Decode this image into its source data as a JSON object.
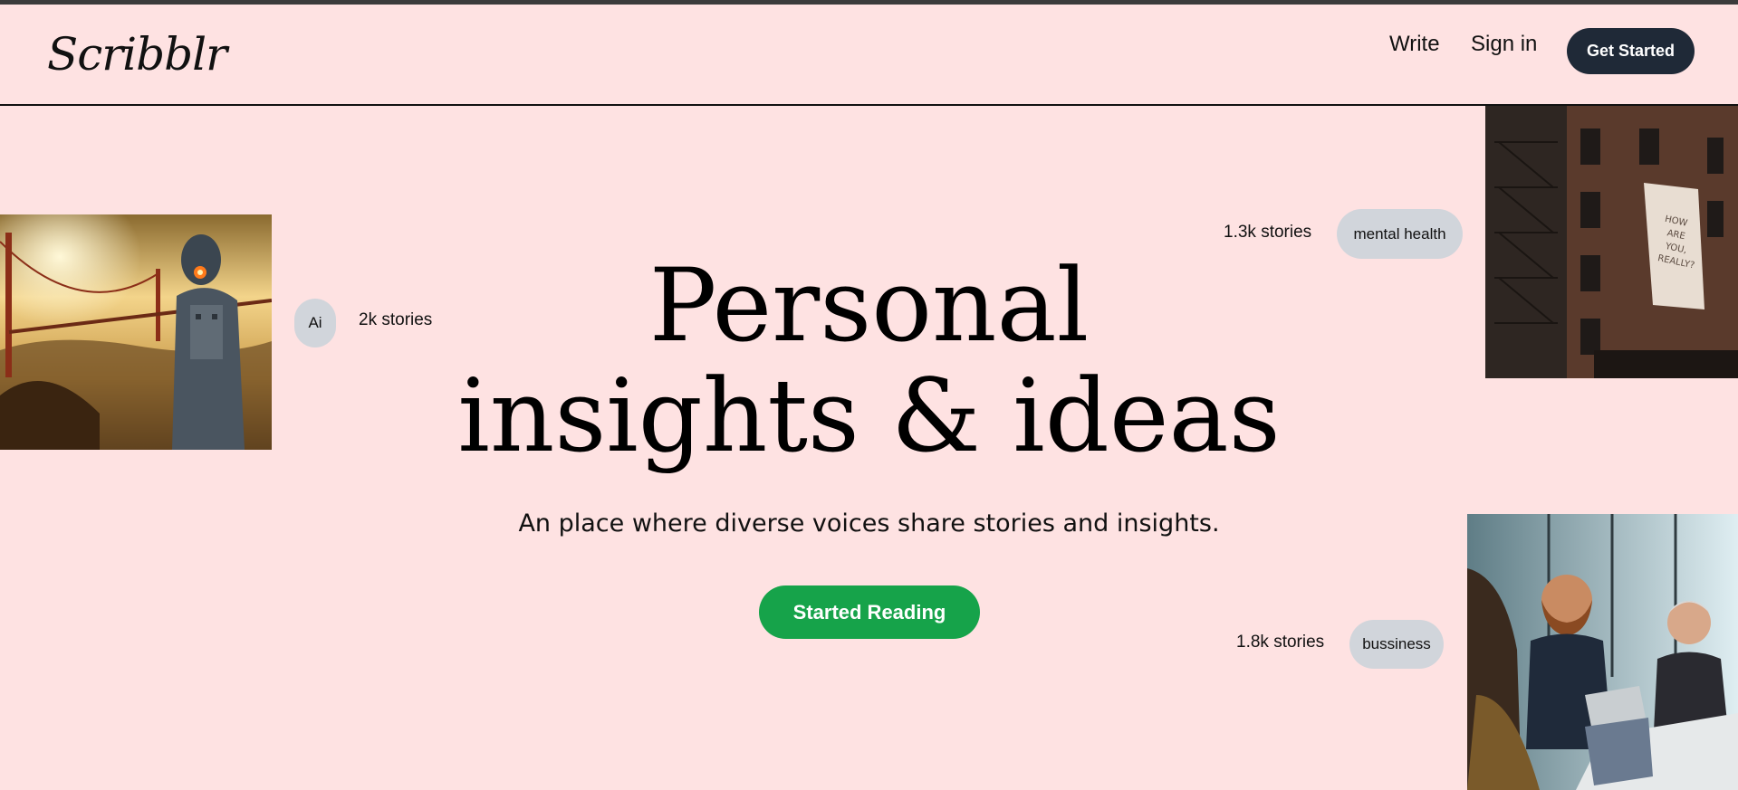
{
  "header": {
    "logo": "Scribblr",
    "nav": {
      "write": "Write",
      "sign_in": "Sign in",
      "get_started": "Get Started"
    }
  },
  "hero": {
    "title_line1": "Personal",
    "title_line2": "insights & ideas",
    "subtitle": "An place where diverse voices share stories and insights.",
    "cta": "Started Reading"
  },
  "topics": [
    {
      "tag": "Ai",
      "count": "2k stories"
    },
    {
      "tag": "mental health",
      "count": "1.3k stories"
    },
    {
      "tag": "bussiness",
      "count": "1.8k stories"
    }
  ],
  "images": {
    "robot": "robot-golden-gate-image",
    "building": "brick-building-mural-image",
    "meeting": "business-meeting-image",
    "mural_text": "HOW ARE YOU, REALLY?"
  },
  "colors": {
    "background": "#fee2e2",
    "primary_button": "#1f2937",
    "cta_button": "#16a34a",
    "tag_pill": "#d1d5db"
  }
}
